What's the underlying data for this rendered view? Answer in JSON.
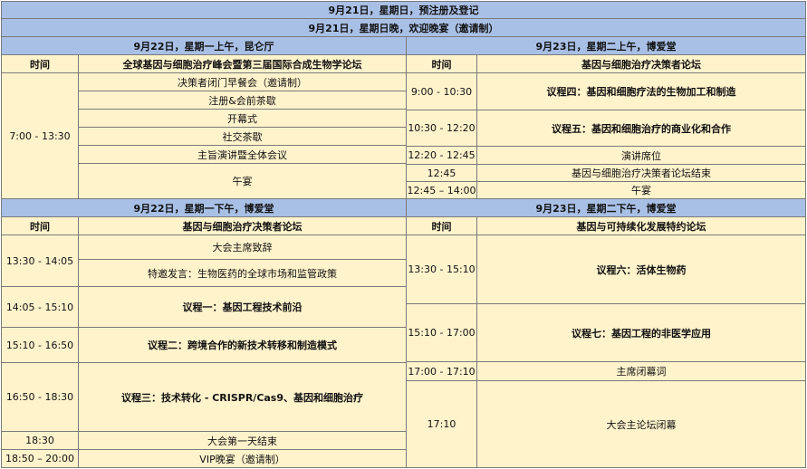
{
  "banner": {
    "line1": "9月21日，星期日，预注册及登记",
    "line2": "9月21日，星期日晚，欢迎晚宴（邀请制）"
  },
  "headers": {
    "mon_am": "9月22日，星期一上午，昆仑厅",
    "tue_am": "9月23日，星期二上午，博爱堂",
    "mon_pm": "9月22日，星期一下午，博爱堂",
    "tue_pm": "9月23日，星期二下午，博爱堂"
  },
  "col_time": "时间",
  "mon_am": {
    "forum": "全球基因与细胞治疗峰会暨第三届国际合成生物学论坛",
    "time": "7:00 - 13:30",
    "items": [
      "决策者闭门早餐会（邀请制）",
      "注册&会前茶歇",
      "开幕式",
      "社交茶歇",
      "主旨演讲暨全体会议",
      "午宴"
    ]
  },
  "tue_am": {
    "forum": "基因与细胞治疗决策者论坛",
    "rows": [
      {
        "time": "9:00 - 10:30",
        "title": "议程四：基因和细胞疗法的生物加工和制造"
      },
      {
        "time": "10:30 - 12:20",
        "title": "议程五：基因和细胞治疗的商业化和合作"
      },
      {
        "time": "12:20 - 12:45",
        "title": "演讲席位"
      },
      {
        "time": "12:45",
        "title": "基因与细胞治疗决策者论坛结束"
      },
      {
        "time": "12:45 – 14:00",
        "title": "午宴"
      }
    ]
  },
  "mon_pm": {
    "forum": "基因与细胞治疗决策者论坛",
    "rows": [
      {
        "time": "13:30 - 14:05",
        "items": [
          "大会主席致辞",
          "特邀发言：生物医药的全球市场和监管政策"
        ]
      },
      {
        "time": "14:05 - 15:10",
        "title": "议程一：基因工程技术前沿"
      },
      {
        "time": "15:10 - 16:50",
        "title": "议程二：跨境合作的新技术转移和制造模式"
      },
      {
        "time": "16:50 - 18:30",
        "title": "议程三：技术转化 - CRISPR/Cas9、基因和细胞治疗"
      },
      {
        "time": "18:30",
        "title": "大会第一天结束"
      },
      {
        "time": "18:50 – 20:00",
        "title": "VIP晚宴（邀请制）"
      }
    ]
  },
  "tue_pm": {
    "forum": "基因与可持续化发展特约论坛",
    "rows": [
      {
        "time": "13:30 - 15:10",
        "title": "议程六：活体生物药"
      },
      {
        "time": "15:10 - 17:00",
        "title": "议程七：基因工程的非医学应用"
      },
      {
        "time": "17:00 - 17:10",
        "title": "主席闭幕词"
      },
      {
        "time": "17:10",
        "title": "大会主论坛闭幕"
      }
    ]
  }
}
